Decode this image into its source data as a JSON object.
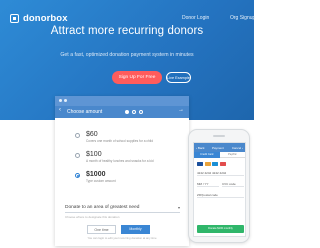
{
  "header": {
    "logo_text": "donorbox",
    "nav": [
      "Donor Login",
      "Org Signup"
    ]
  },
  "hero": {
    "headline": "Attract more recurring donors",
    "subline": "Get a fast, optimized donation payment system in minutes",
    "cta_primary": "Sign Up For Free",
    "cta_secondary": "Live Example",
    "bg_color": "#2a7ccb",
    "cta_color": "#ff5c5c"
  },
  "form": {
    "back_icon": "‹",
    "title": "Choose amount",
    "next_icon": "→",
    "amounts": [
      {
        "value": "60",
        "desc": "Covers one month of school supplies for a child"
      },
      {
        "value": "100",
        "desc": "A month of healthy lunches and snacks for a kid"
      },
      {
        "value": "1000",
        "desc": "Type custom amount"
      }
    ],
    "designation": "Donate to an area of greatest need",
    "designation_hint": "Choose where to designate this donation",
    "frequency": [
      "One time",
      "Monthly"
    ],
    "footer": "You can login to edit your recurring donation at any time"
  },
  "phone": {
    "header_left": "‹ Back",
    "header_center": "Payment",
    "header_right": "Cancel ›",
    "tabs": [
      "Credit Card",
      "PayPal"
    ],
    "fields": [
      "4242 4242 4242 4242",
      "MM / YY",
      "CVC code",
      "ZIP/postal code"
    ],
    "button": "Donate $100 monthly",
    "card_colors": [
      "#1a4f9c",
      "#e8a23a",
      "#1a8fd4",
      "#e24c4c"
    ]
  }
}
